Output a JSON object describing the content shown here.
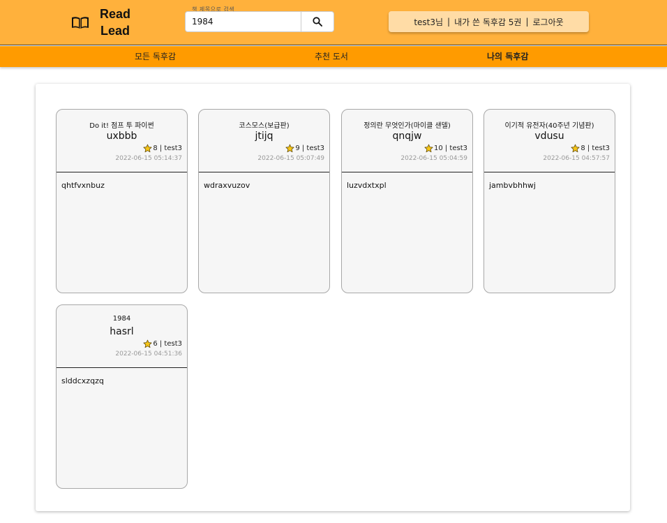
{
  "header": {
    "logo_line1": "Read",
    "logo_line2": "Lead",
    "search_label": "책 제목으로 검색",
    "search_value": "1984",
    "user_greeting": "test3님",
    "my_reviews_count": "내가 쓴 독후감 5권",
    "logout_label": "로그아웃"
  },
  "nav": {
    "all_reviews": "모든 독후감",
    "recommended": "추천 도서",
    "my_reviews": "나의 독후감"
  },
  "reviews": [
    {
      "book_title": "Do it! 점프 투 파이썬",
      "title": "uxbbb",
      "rating": "8",
      "author": "test3",
      "date": "2022-06-15 05:14:37",
      "body": "qhtfvxnbuz"
    },
    {
      "book_title": "코스모스(보급판)",
      "title": "jtijq",
      "rating": "9",
      "author": "test3",
      "date": "2022-06-15 05:07:49",
      "body": "wdraxvuzov"
    },
    {
      "book_title": "정의란 무엇인가(마이클 샌델)",
      "title": "qnqjw",
      "rating": "10",
      "author": "test3",
      "date": "2022-06-15 05:04:59",
      "body": "luzvdxtxpl"
    },
    {
      "book_title": "이기적 유전자(40주년 기념판)",
      "title": "vdusu",
      "rating": "8",
      "author": "test3",
      "date": "2022-06-15 04:57:57",
      "body": "jambvbhhwj"
    },
    {
      "book_title": "1984",
      "title": "hasrl",
      "rating": "6",
      "author": "test3",
      "date": "2022-06-15 04:51:36",
      "body": "slddcxzqzq"
    }
  ],
  "colors": {
    "header_bg": "#ffb13c",
    "nav_bg": "#ff9b00",
    "user_box_bg": "#ffdca6",
    "star": "#f5c518"
  },
  "icons": {
    "logo": "open-book-icon",
    "search": "magnifier-icon",
    "rating": "star-icon"
  }
}
